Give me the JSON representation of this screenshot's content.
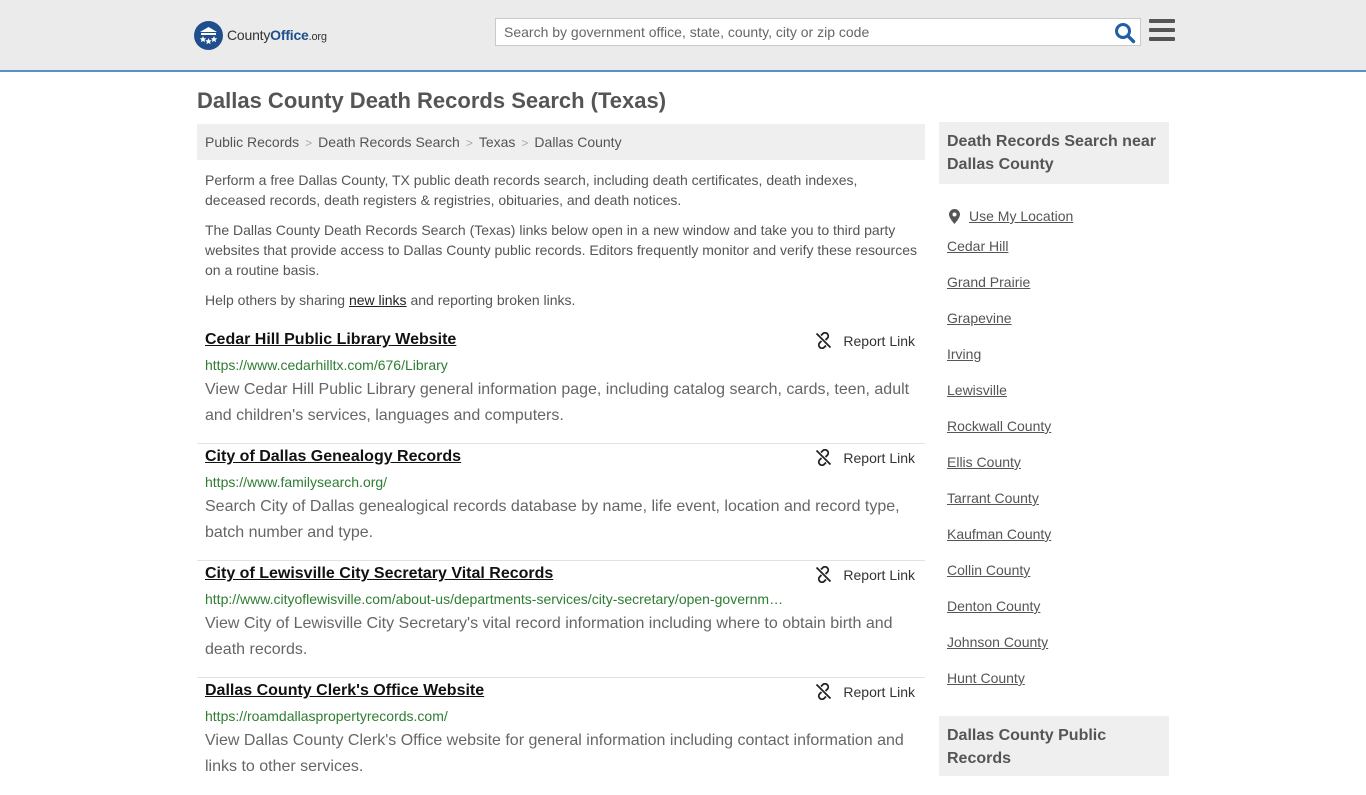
{
  "header": {
    "logo_text_county": "County",
    "logo_text_office": "Office",
    "logo_text_org": ".org",
    "search_placeholder": "Search by government office, state, county, city or zip code"
  },
  "page_title": "Dallas County Death Records Search (Texas)",
  "breadcrumb": [
    "Public Records",
    "Death Records Search",
    "Texas",
    "Dallas County"
  ],
  "intro": {
    "p1": "Perform a free Dallas County, TX public death records search, including death certificates, death indexes, deceased records, death registers & registries, obituaries, and death notices.",
    "p2": "The Dallas County Death Records Search (Texas) links below open in a new window and take you to third party websites that provide access to Dallas County public records. Editors frequently monitor and verify these resources on a routine basis.",
    "p3_before": "Help others by sharing ",
    "p3_link": "new links",
    "p3_after": " and reporting broken links."
  },
  "report_label": "Report Link",
  "results": [
    {
      "title": "Cedar Hill Public Library Website",
      "url": "https://www.cedarhilltx.com/676/Library",
      "desc": "View Cedar Hill Public Library general information page, including catalog search, cards, teen, adult and children's services, languages and computers."
    },
    {
      "title": "City of Dallas Genealogy Records",
      "url": "https://www.familysearch.org/",
      "desc": "Search City of Dallas genealogical records database by name, life event, location and record type, batch number and type."
    },
    {
      "title": "City of Lewisville City Secretary Vital Records",
      "url": "http://www.cityoflewisville.com/about-us/departments-services/city-secretary/open-governm…",
      "desc": "View City of Lewisville City Secretary's vital record information including where to obtain birth and death records."
    },
    {
      "title": "Dallas County Clerk's Office Website",
      "url": "https://roamdallaspropertyrecords.com/",
      "desc": "View Dallas County Clerk's Office website for general information including contact information and links to other services."
    }
  ],
  "sidebar": {
    "heading1": "Death Records Search near Dallas County",
    "use_location": "Use My Location",
    "nearby": [
      "Cedar Hill",
      "Grand Prairie",
      "Grapevine",
      "Irving",
      "Lewisville",
      "Rockwall County",
      "Ellis County",
      "Tarrant County",
      "Kaufman County",
      "Collin County",
      "Denton County",
      "Johnson County",
      "Hunt County"
    ],
    "heading2": "Dallas County Public Records"
  },
  "colors": {
    "accent_border": "#5a8fc8",
    "logo_blue": "#1f4e8c",
    "url_green": "#2e7d32",
    "search_icon": "#1f5fa8"
  }
}
